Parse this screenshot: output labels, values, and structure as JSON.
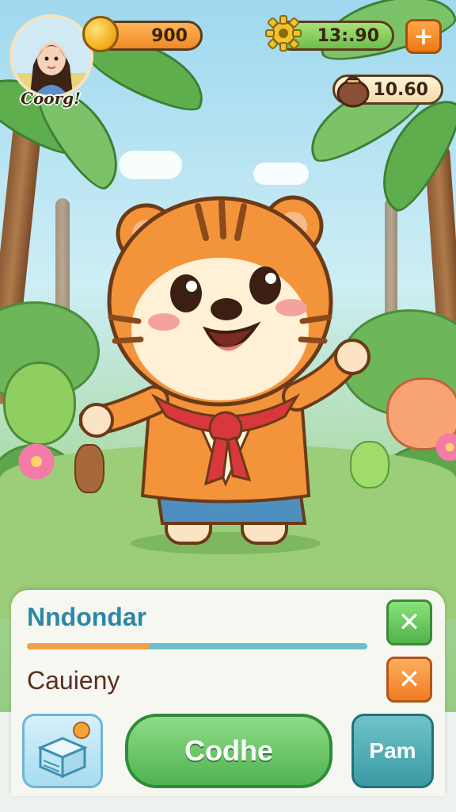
{
  "hud": {
    "coins": "900",
    "timer": "13:.90",
    "bag_count": "10.60",
    "plus_label": "+"
  },
  "player": {
    "name": "Coorg!"
  },
  "panel": {
    "name": "Nndondar",
    "progress": 0.36,
    "category": "Cauieny",
    "close_label": "✕"
  },
  "actions": {
    "main_label": "Codhe",
    "side_label": "Pam"
  },
  "colors": {
    "accent_green": "#4fb352",
    "accent_orange": "#f07c22",
    "name_blue": "#2e86a6"
  }
}
